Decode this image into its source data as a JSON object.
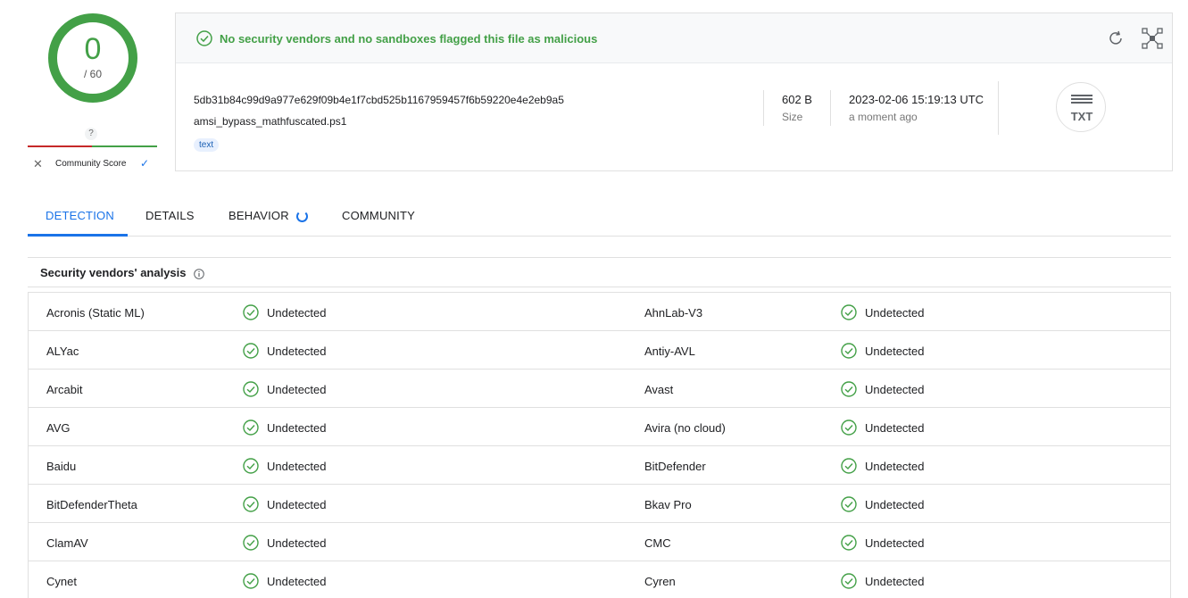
{
  "score": {
    "detections": "0",
    "total": "/ 60"
  },
  "community": {
    "unknown": "?",
    "label": "Community Score",
    "colors": {
      "bad": "#c62828",
      "good": "#43a047"
    }
  },
  "header": {
    "status_text": "No security vendors and no sandboxes flagged this file as malicious",
    "status_color": "#43a047",
    "hash": "5db31b84c99d9a977e629f09b4e1f7cbd525b1167959457f6b59220e4e2eb9a5",
    "filename": "amsi_bypass_mathfuscated.ps1",
    "tag": "text",
    "size_value": "602 B",
    "size_label": "Size",
    "date_value": "2023-02-06 15:19:13 UTC",
    "date_label": "a moment ago",
    "file_type": "TXT"
  },
  "tabs": [
    {
      "label": "DETECTION",
      "active": true
    },
    {
      "label": "DETAILS",
      "active": false
    },
    {
      "label": "BEHAVIOR",
      "active": false
    },
    {
      "label": "COMMUNITY",
      "active": false
    }
  ],
  "section": {
    "title": "Security vendors' analysis"
  },
  "vendors": [
    {
      "left": "Acronis (Static ML)",
      "left_result": "Undetected",
      "right": "AhnLab-V3",
      "right_result": "Undetected"
    },
    {
      "left": "ALYac",
      "left_result": "Undetected",
      "right": "Antiy-AVL",
      "right_result": "Undetected"
    },
    {
      "left": "Arcabit",
      "left_result": "Undetected",
      "right": "Avast",
      "right_result": "Undetected"
    },
    {
      "left": "AVG",
      "left_result": "Undetected",
      "right": "Avira (no cloud)",
      "right_result": "Undetected"
    },
    {
      "left": "Baidu",
      "left_result": "Undetected",
      "right": "BitDefender",
      "right_result": "Undetected"
    },
    {
      "left": "BitDefenderTheta",
      "left_result": "Undetected",
      "right": "Bkav Pro",
      "right_result": "Undetected"
    },
    {
      "left": "ClamAV",
      "left_result": "Undetected",
      "right": "CMC",
      "right_result": "Undetected"
    },
    {
      "left": "Cynet",
      "left_result": "Undetected",
      "right": "Cyren",
      "right_result": "Undetected"
    }
  ]
}
